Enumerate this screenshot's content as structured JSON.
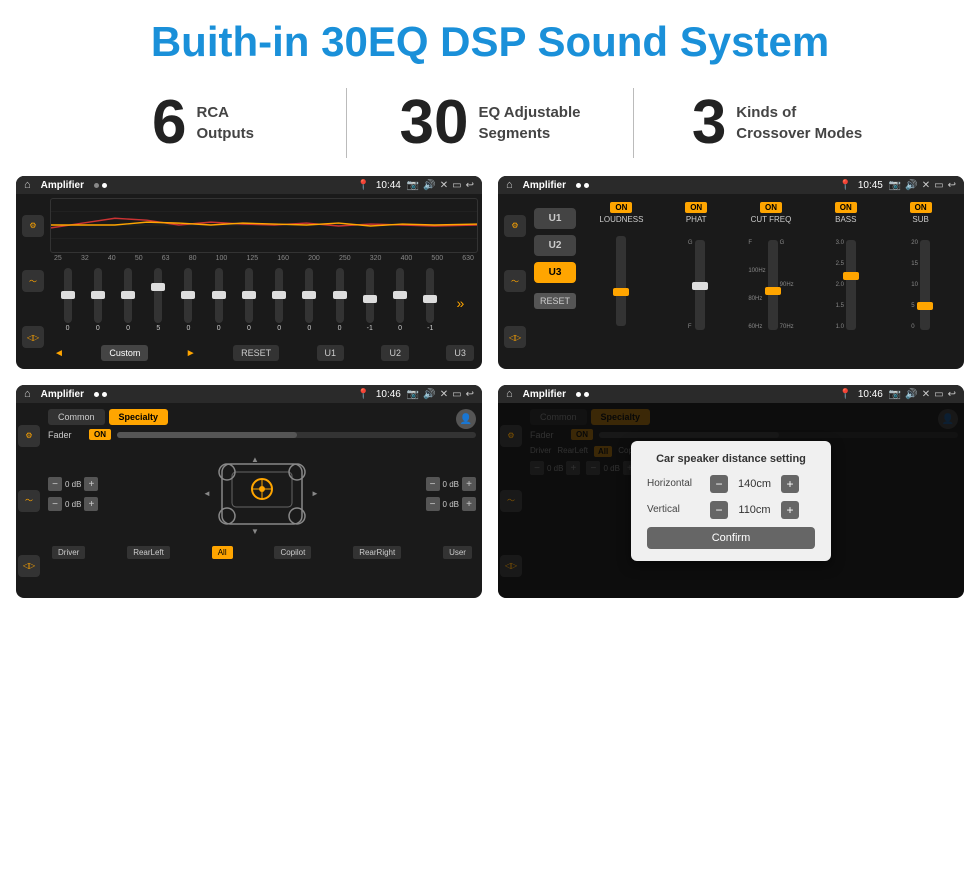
{
  "title": "Buith-in 30EQ DSP Sound System",
  "stats": [
    {
      "number": "6",
      "line1": "RCA",
      "line2": "Outputs"
    },
    {
      "number": "30",
      "line1": "EQ Adjustable",
      "line2": "Segments"
    },
    {
      "number": "3",
      "line1": "Kinds of",
      "line2": "Crossover Modes"
    }
  ],
  "screen1": {
    "title": "Amplifier",
    "time": "10:44",
    "freq_labels": [
      "25",
      "32",
      "40",
      "50",
      "63",
      "80",
      "100",
      "125",
      "160",
      "200",
      "250",
      "320",
      "400",
      "500",
      "630"
    ],
    "slider_values": [
      "0",
      "0",
      "0",
      "5",
      "0",
      "0",
      "0",
      "0",
      "0",
      "0",
      "-1",
      "0",
      "-1"
    ],
    "preset_label": "Custom",
    "buttons": [
      "RESET",
      "U1",
      "U2",
      "U3"
    ]
  },
  "screen2": {
    "title": "Amplifier",
    "time": "10:45",
    "presets": [
      "U1",
      "U2",
      "U3"
    ],
    "channels": [
      {
        "label": "LOUDNESS",
        "on": true
      },
      {
        "label": "PHAT",
        "on": true
      },
      {
        "label": "CUT FREQ",
        "on": true
      },
      {
        "label": "BASS",
        "on": true
      },
      {
        "label": "SUB",
        "on": true
      }
    ],
    "reset_label": "RESET"
  },
  "screen3": {
    "title": "Amplifier",
    "time": "10:46",
    "tabs": [
      "Common",
      "Specialty"
    ],
    "fader_label": "Fader",
    "on_label": "ON",
    "labels": [
      "Driver",
      "RearLeft",
      "All",
      "Copilot",
      "RearRight",
      "User"
    ],
    "db_values": [
      "0 dB",
      "0 dB",
      "0 dB",
      "0 dB"
    ]
  },
  "screen4": {
    "title": "Amplifier",
    "time": "10:46",
    "tabs": [
      "Common",
      "Specialty"
    ],
    "dialog": {
      "title": "Car speaker distance setting",
      "horizontal_label": "Horizontal",
      "horizontal_value": "140cm",
      "vertical_label": "Vertical",
      "vertical_value": "110cm",
      "confirm_label": "Confirm",
      "db_values": [
        "0 dB",
        "0 dB"
      ]
    }
  }
}
